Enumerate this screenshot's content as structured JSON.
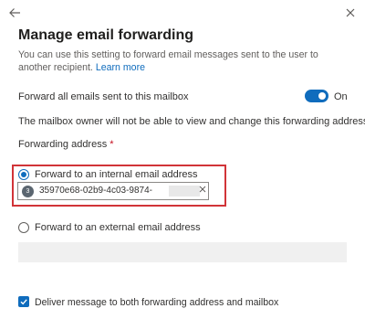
{
  "header": {
    "back_icon": "arrow-left-icon",
    "close_icon": "close-icon",
    "title": "Manage email forwarding"
  },
  "description": {
    "text": "You can use this setting to forward email messages sent to the user to another recipient. ",
    "link": "Learn more"
  },
  "forward_all": {
    "label": "Forward all emails sent to this mailbox",
    "toggle_state": "On",
    "toggle_on": true,
    "note": "The mailbox owner will not be able to view and change this forwarding address."
  },
  "forwarding_address": {
    "label": "Forwarding address",
    "required_marker": "*",
    "options": [
      {
        "label": "Forward to an internal email address",
        "selected": true,
        "recipient": {
          "avatar_initial": "3",
          "text": "35970e68-02b9-4c03-9874-",
          "remove_icon": "close-icon"
        }
      },
      {
        "label": "Forward to an external email address",
        "selected": false,
        "input_value": ""
      }
    ]
  },
  "deliver_both": {
    "label": "Deliver message to both forwarding address and mailbox",
    "checked": true
  },
  "colors": {
    "accent": "#0f6cbd",
    "highlight_border": "#d13438",
    "required": "#c50f1f"
  }
}
